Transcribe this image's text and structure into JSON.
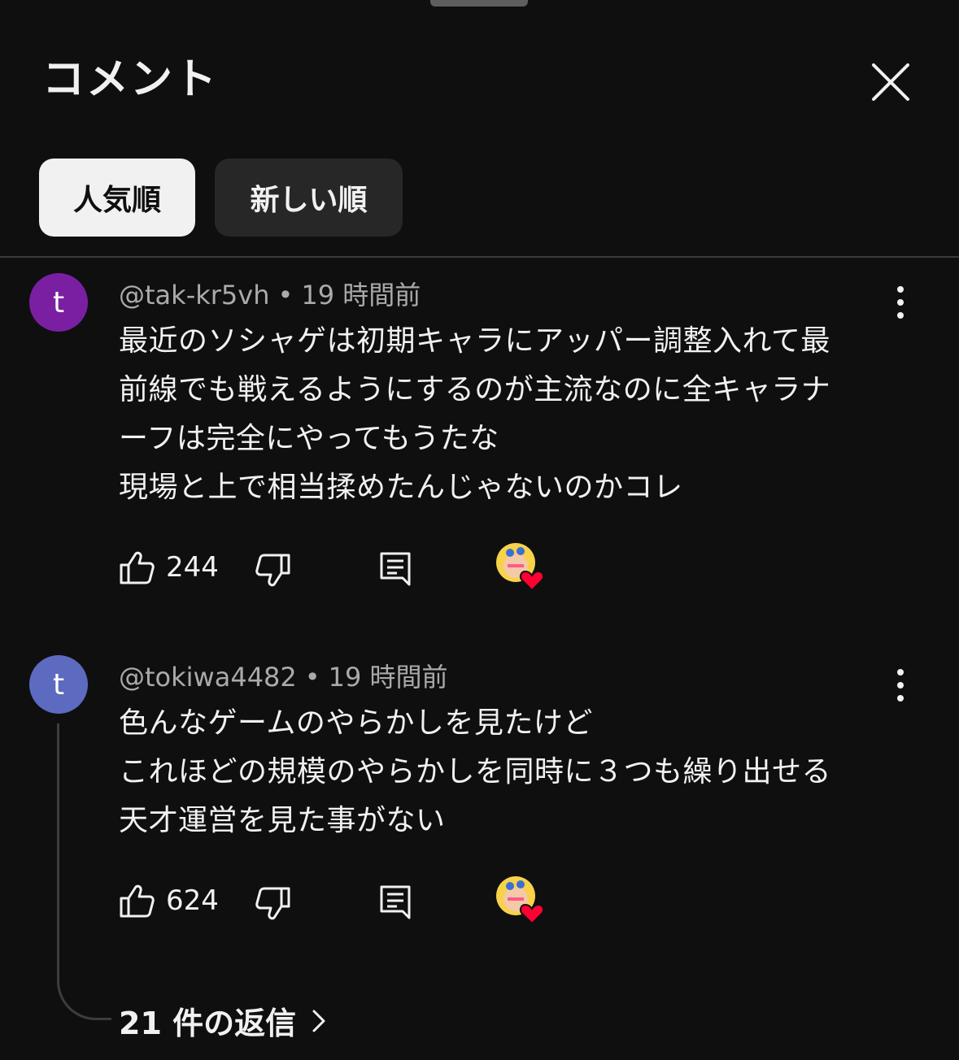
{
  "header": {
    "title": "コメント",
    "close_icon": "close-icon"
  },
  "sort_chips": [
    {
      "label": "人気順",
      "selected": true
    },
    {
      "label": "新しい順",
      "selected": false
    }
  ],
  "comments": [
    {
      "avatar_letter": "t",
      "avatar_color": "#7b1fa2",
      "author": "@tak-kr5vh",
      "separator": "•",
      "time": "19 時間前",
      "text": "最近のソシャゲは初期キャラにアッパー調整入れて最\n前線でも戦えるようにするのが主流なのに全キャラナ\nーフは完全にやってもうたな\n現場と上で相当揉めたんじゃないのかコレ",
      "likes": "244"
    },
    {
      "avatar_letter": "t",
      "avatar_color": "#5c6bc0",
      "author": "@tokiwa4482",
      "separator": "•",
      "time": "19 時間前",
      "text": "色んなゲームのやらかしを見たけど\nこれほどの規模のやらかしを同時に３つも繰り出せる\n天才運営を見た事がない",
      "likes": "624",
      "replies_label": "21 件の返信"
    }
  ],
  "colors": {
    "background": "#0f0f0f",
    "heart": "#ff0033"
  }
}
